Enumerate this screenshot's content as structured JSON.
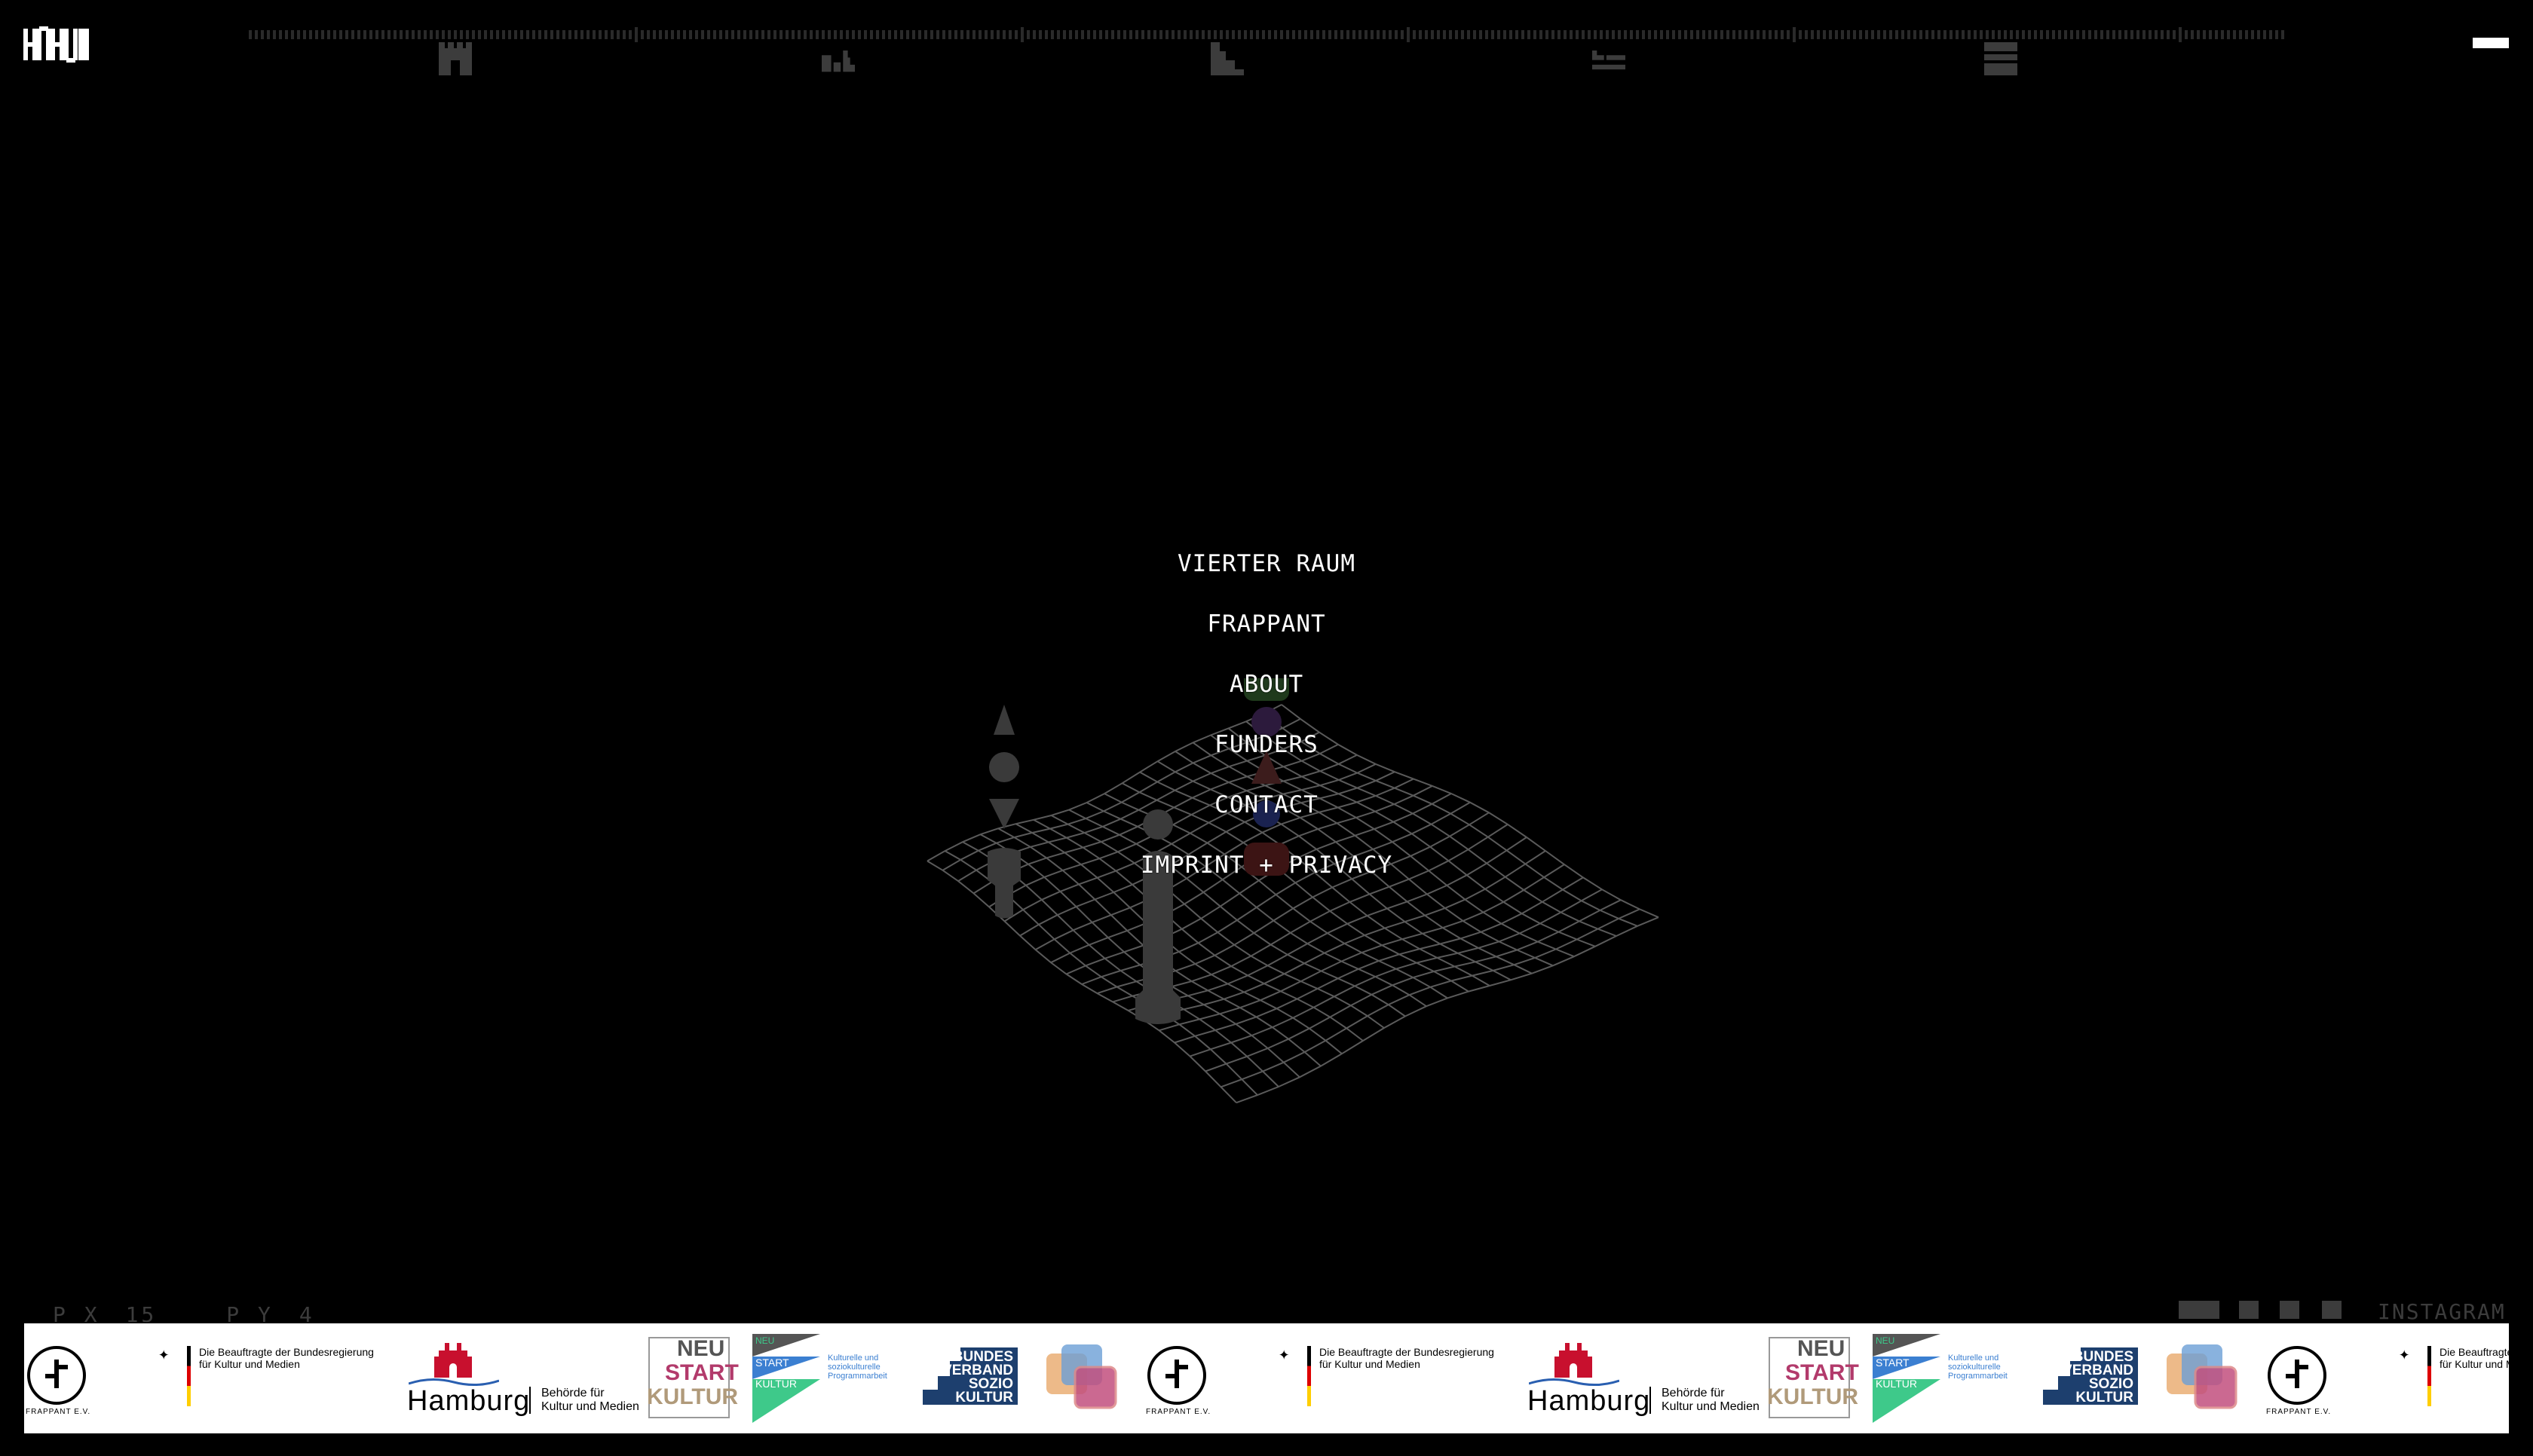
{
  "nav": {
    "items": [
      {
        "label": "VIERTER RAUM"
      },
      {
        "label": "FRAPPANT"
      },
      {
        "label": "ABOUT"
      },
      {
        "label": "FUNDERS"
      },
      {
        "label": "CONTACT"
      },
      {
        "label": "IMPRINT + PRIVACY"
      }
    ]
  },
  "readout": {
    "px_label": "P X",
    "px_value": "15",
    "py_label": "P Y",
    "py_value": "4"
  },
  "social": {
    "instagram": "INSTAGRAM"
  },
  "funders": {
    "frappant_label": "FRAPPANT E.V.",
    "bkm_line1": "Die Beauftragte der Bundesregierung",
    "bkm_line2": "für Kultur und Medien",
    "hamburg_word": "Hamburg",
    "hamburg_sub1": "Behörde für",
    "hamburg_sub2": "Kultur und Medien",
    "neustart": [
      "NEU",
      "START",
      "KULTUR"
    ],
    "soziokultur_neu": "NEU",
    "soziokultur_start": "START",
    "soziokultur_kultur": "KULTUR",
    "soziokultur_text1": "Kulturelle und",
    "soziokultur_text2": "soziokulturelle",
    "soziokultur_text3": "Programmarbeit",
    "bundesverband": [
      "BUNDES",
      "VERBAND",
      "SOZIO",
      "KULTUR"
    ]
  },
  "colors": {
    "background": "#000000",
    "text": "#ffffff",
    "dim": "#3c3c3c",
    "grid": "#5a5a5a",
    "hamburg_red": "#c8102e",
    "neustart_pink": "#b23a6b",
    "neustart_tan": "#b09a7a",
    "sozio_green": "#3ec98a",
    "sozio_blue": "#3b7fd1",
    "bv_navy": "#1d3f6e"
  }
}
